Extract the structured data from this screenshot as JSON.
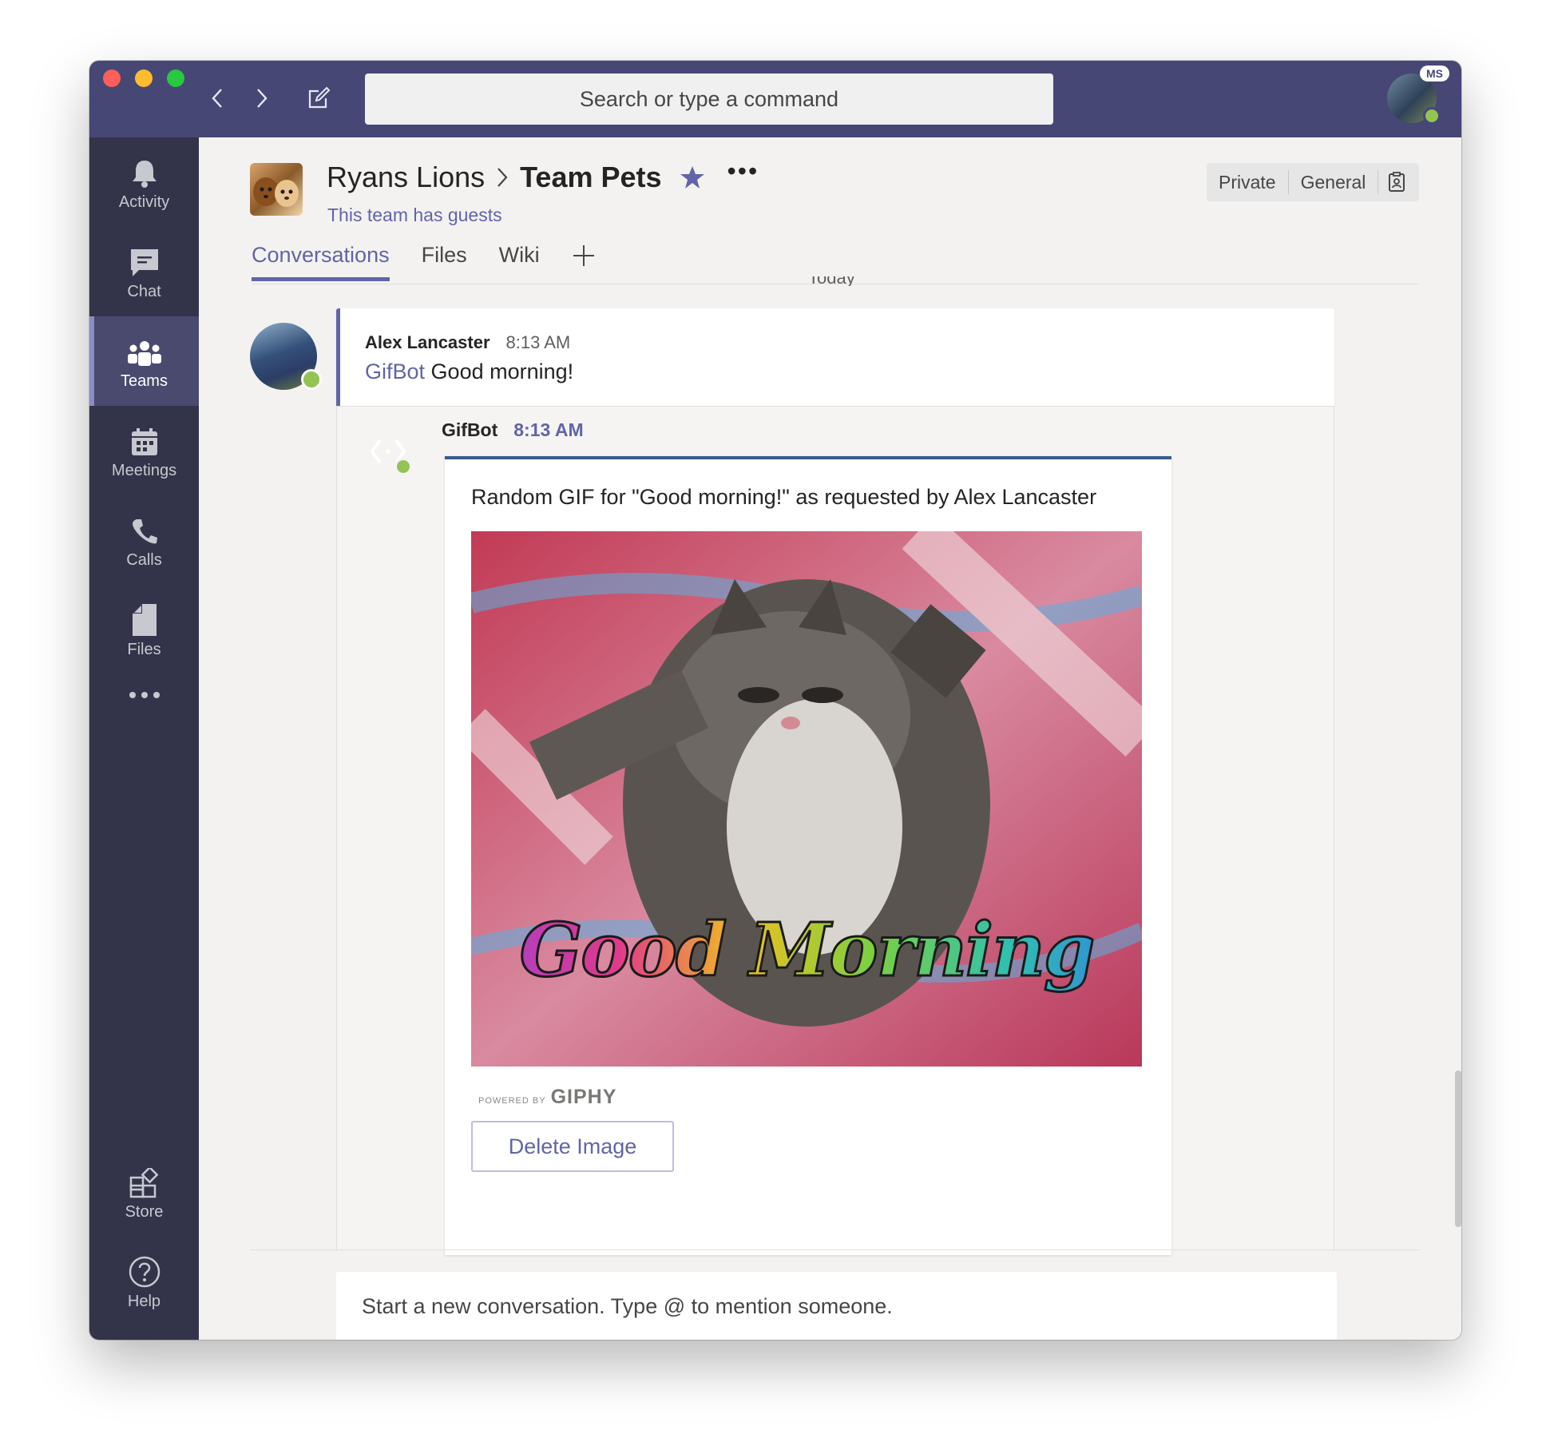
{
  "search": {
    "placeholder": "Search or type a command"
  },
  "user": {
    "badge": "MS"
  },
  "rail": {
    "items": [
      {
        "label": "Activity",
        "icon": "bell-icon"
      },
      {
        "label": "Chat",
        "icon": "chat-icon"
      },
      {
        "label": "Teams",
        "icon": "teams-icon",
        "active": true
      },
      {
        "label": "Meetings",
        "icon": "calendar-icon"
      },
      {
        "label": "Calls",
        "icon": "phone-icon"
      },
      {
        "label": "Files",
        "icon": "file-icon"
      },
      {
        "label": "",
        "icon": "more-icon"
      }
    ],
    "bottom": [
      {
        "label": "Store",
        "icon": "store-icon"
      },
      {
        "label": "Help",
        "icon": "help-icon"
      }
    ]
  },
  "header": {
    "team": "Ryans Lions",
    "channel": "Team Pets",
    "guests": "This team has guests",
    "tags": [
      "Private",
      "General"
    ]
  },
  "tabs": [
    "Conversations",
    "Files",
    "Wiki"
  ],
  "today_label": "Today",
  "message": {
    "author": "Alex Lancaster",
    "time": "8:13 AM",
    "mention": "GifBot",
    "text": "Good morning!"
  },
  "reply": {
    "author": "GifBot",
    "time": "8:13 AM",
    "card_title": "Random GIF for \"Good morning!\" as requested by Alex Lancaster",
    "gif_caption": "Good Morning",
    "powered_small": "POWERED BY",
    "powered_big": "GIPHY",
    "delete_label": "Delete Image"
  },
  "compose": {
    "placeholder": "Start a new conversation. Type @ to mention someone."
  },
  "colors": {
    "brand": "#6264a7",
    "titlebar": "#464775",
    "rail": "#33344a",
    "status_available": "#92c353"
  }
}
